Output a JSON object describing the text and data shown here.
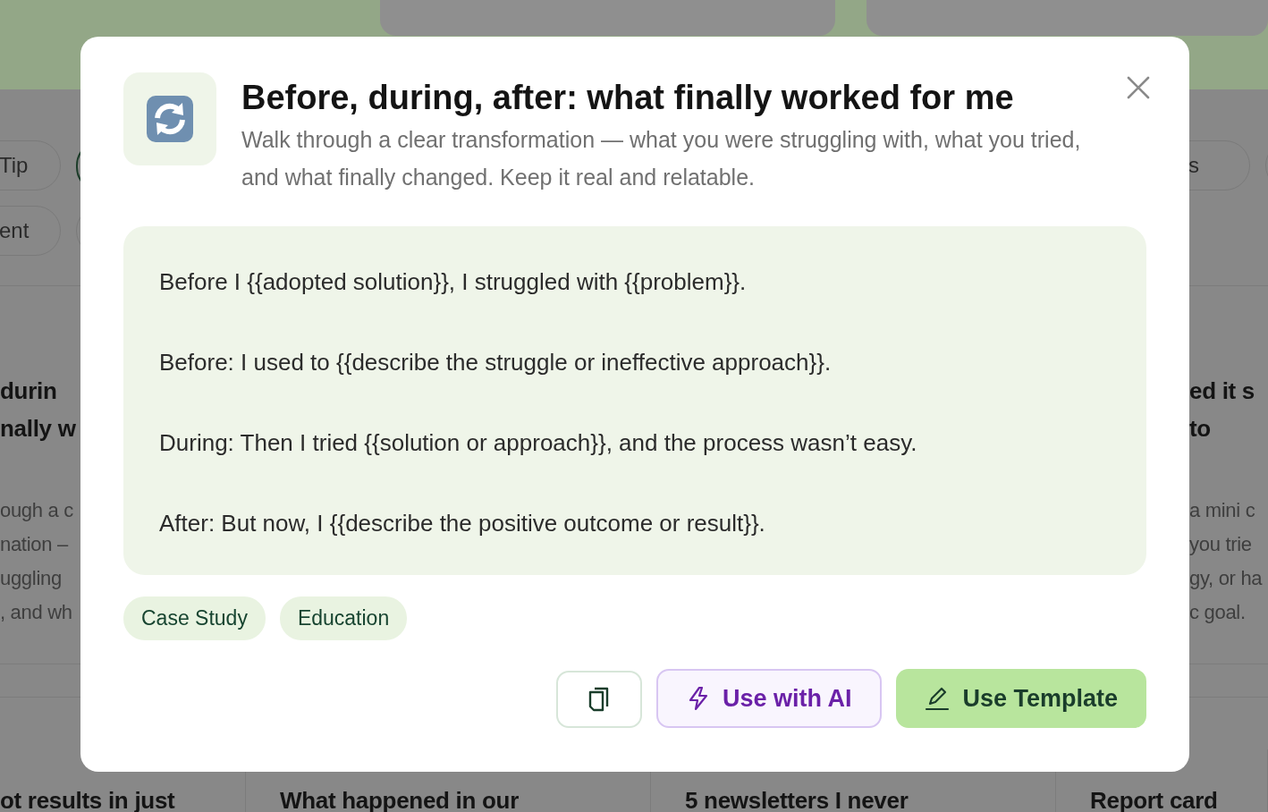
{
  "background": {
    "left": {
      "pills": [
        {
          "label": "Tip",
          "selected": false
        },
        {
          "selected": true
        }
      ],
      "pills_row_2": [
        {
          "label": "ent",
          "selected": false
        },
        {
          "selected": false
        }
      ],
      "card_title": [
        "durin",
        "nally w"
      ],
      "card_text": [
        "ough a c",
        "nation –",
        "uggling",
        ", and wh"
      ]
    },
    "right": {
      "pills": [
        {
          "label": "s",
          "selected": false
        },
        {
          "selected": false
        }
      ],
      "card_title": [
        "ed it s",
        "to"
      ],
      "card_text": [
        "a mini c",
        "you trie",
        "gy, or ha",
        "c goal."
      ]
    },
    "bottom_cards": [
      "ot results in just",
      "What happened in our",
      "5 newsletters I never",
      "Report card"
    ]
  },
  "modal": {
    "title": "Before, during, after: what finally worked for me",
    "description": "Walk through a clear transformation — what you were struggling with, what you tried, and what finally changed. Keep it real and relatable.",
    "template_lines": [
      "Before I {{adopted solution}}, I struggled with {{problem}}.",
      "Before: I used to {{describe the struggle or ineffective approach}}.",
      "During: Then I tried {{solution or approach}}, and the process wasn’t easy.",
      "After: But now, I {{describe the positive outcome or result}}."
    ],
    "tags": [
      "Case Study",
      "Education"
    ],
    "buttons": [
      {
        "kind": "copy"
      },
      {
        "kind": "ai",
        "label": "Use with AI"
      },
      {
        "kind": "primary",
        "label": "Use Template"
      }
    ]
  }
}
